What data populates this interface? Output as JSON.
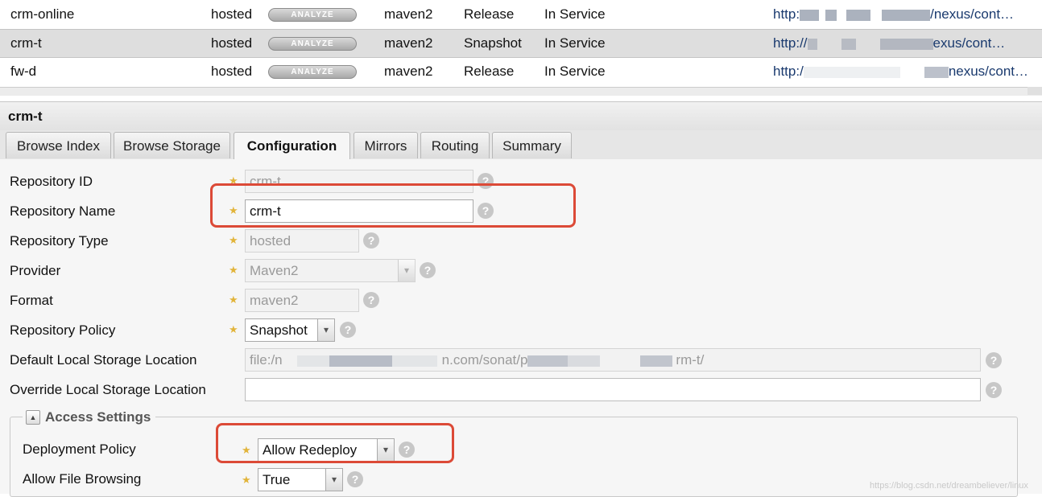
{
  "grid": {
    "analyze_label": "ANALYZE",
    "rows": [
      {
        "name": "crm-online",
        "type": "hosted",
        "format": "maven2",
        "policy": "Release",
        "status": "In Service",
        "url_start": "http:",
        "url_end": "/nexus/cont…"
      },
      {
        "name": "crm-t",
        "type": "hosted",
        "format": "maven2",
        "policy": "Snapshot",
        "status": "In Service",
        "url_start": "http://",
        "url_end": "exus/cont…"
      },
      {
        "name": "fw-d",
        "type": "hosted",
        "format": "maven2",
        "policy": "Release",
        "status": "In Service",
        "url_start": "http:/",
        "url_end": "nexus/cont…"
      }
    ]
  },
  "panel": {
    "title": "crm-t",
    "tabs": [
      "Browse Index",
      "Browse Storage",
      "Configuration",
      "Mirrors",
      "Routing",
      "Summary"
    ],
    "active_tab": "Configuration"
  },
  "form": {
    "repository_id": {
      "label": "Repository ID",
      "value": "crm-t"
    },
    "repository_name": {
      "label": "Repository Name",
      "value": "crm-t"
    },
    "repository_type": {
      "label": "Repository Type",
      "value": "hosted"
    },
    "provider": {
      "label": "Provider",
      "value": "Maven2"
    },
    "format": {
      "label": "Format",
      "value": "maven2"
    },
    "repository_policy": {
      "label": "Repository Policy",
      "value": "Snapshot"
    },
    "default_storage": {
      "label": "Default Local Storage Location",
      "value_start": "file:/n",
      "value_mid": "n.com/sonat/p",
      "value_end": "rm-t/"
    },
    "override_storage": {
      "label": "Override Local Storage Location",
      "value": ""
    },
    "access_settings": {
      "legend": "Access Settings",
      "deployment_policy": {
        "label": "Deployment Policy",
        "value": "Allow Redeploy"
      },
      "allow_file_browsing": {
        "label": "Allow File Browsing",
        "value": "True"
      }
    }
  },
  "watermark": "https://blog.csdn.net/dreambeliever/linux",
  "colors": {
    "highlight_border": "#dc4a37",
    "required_star": "#e2b43a",
    "url_link": "#1a3a6e"
  },
  "icons": {
    "help": "?",
    "combo": "▾",
    "collapse": "▲",
    "required": "★"
  }
}
